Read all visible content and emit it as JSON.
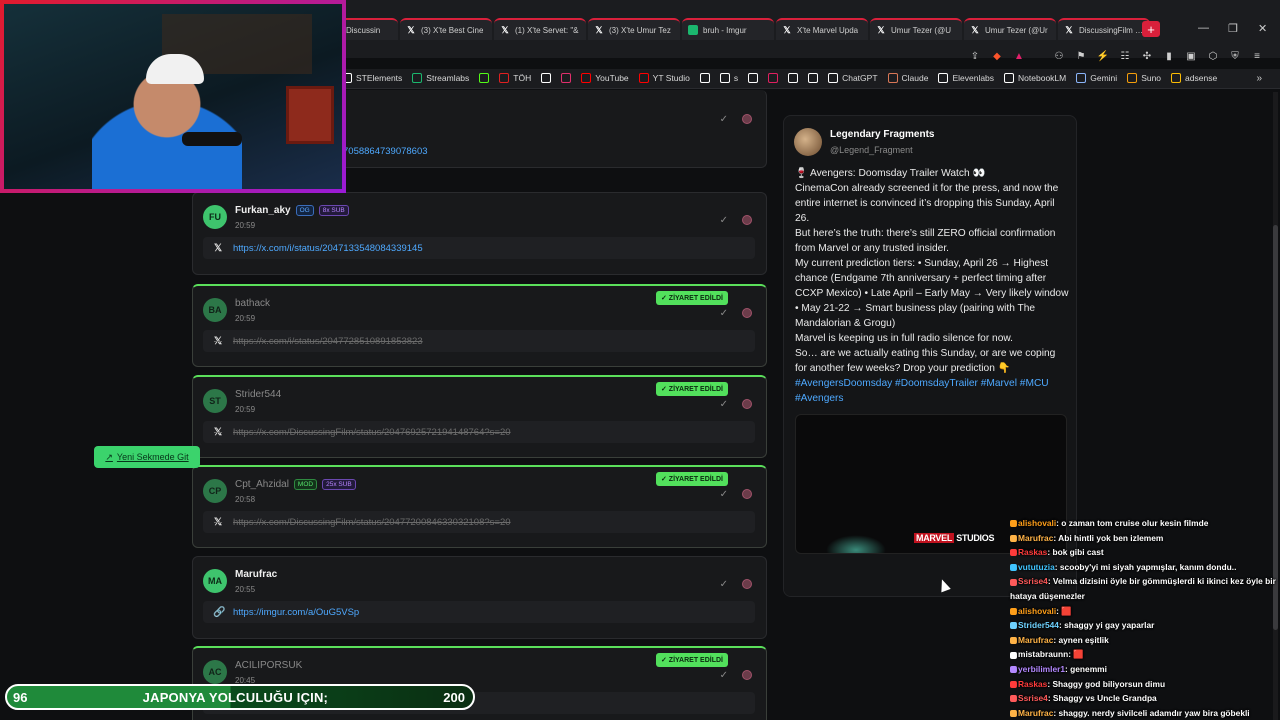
{
  "tabs": [
    {
      "icon": "",
      "label": "Discussin"
    },
    {
      "icon": "X",
      "label": "(3) X'te Best Cine"
    },
    {
      "icon": "X",
      "label": "(1) X'te Servet: \"&"
    },
    {
      "icon": "X",
      "label": "(3) X'te Umur Tez"
    },
    {
      "icon": "imgur",
      "label": "bruh - Imgur"
    },
    {
      "icon": "X",
      "label": "X'te Marvel Upda"
    },
    {
      "icon": "X",
      "label": "Umur Tezer (@U"
    },
    {
      "icon": "X",
      "label": "Umur Tezer (@Ur"
    },
    {
      "icon": "X",
      "label": "DiscussingFilm (@"
    }
  ],
  "new_tab": "+",
  "bookmarks": [
    {
      "label": "STElements",
      "color": "#ffffff"
    },
    {
      "label": "Streamlabs",
      "color": "#1bb76e"
    },
    {
      "label": "",
      "color": "#53fc18"
    },
    {
      "label": "TÖH",
      "color": "#e02020"
    },
    {
      "label": "",
      "color": "#ffffff"
    },
    {
      "label": "",
      "color": "#e1306c"
    },
    {
      "label": "YouTube",
      "color": "#ff0000"
    },
    {
      "label": "YT Studio",
      "color": "#ff0000"
    },
    {
      "label": "",
      "color": "#ffffff"
    },
    {
      "label": "s",
      "color": "#ffffff"
    },
    {
      "label": "",
      "color": "#ffffff"
    },
    {
      "label": "",
      "color": "#e02060"
    },
    {
      "label": "",
      "color": "#ffffff"
    },
    {
      "label": "",
      "color": "#ffffff"
    },
    {
      "label": "ChatGPT",
      "color": "#ffffff"
    },
    {
      "label": "Claude",
      "color": "#d97757"
    },
    {
      "label": "Elevenlabs",
      "color": "#ffffff"
    },
    {
      "label": "NotebookLM",
      "color": "#ffffff"
    },
    {
      "label": "Gemini",
      "color": "#8ab4f8"
    },
    {
      "label": "Suno",
      "color": "#f59e0b"
    },
    {
      "label": "adsense",
      "color": "#fbbc04"
    }
  ],
  "messages": [
    {
      "initials": "",
      "user": "",
      "time": "",
      "link": "7058864739078603",
      "link_icon": "X",
      "visited": false,
      "badges": []
    },
    {
      "initials": "FU",
      "user": "Furkan_aky",
      "time": "20:59",
      "link": "https://x.com/i/status/2047133548084339145",
      "link_icon": "X",
      "visited": false,
      "badges": [
        {
          "text": "OG",
          "kind": "og"
        },
        {
          "text": "8x SUB",
          "kind": "sub"
        }
      ]
    },
    {
      "initials": "BA",
      "user": "bathack",
      "time": "20:59",
      "link": "https://x.com/i/status/2047728510891853823",
      "link_icon": "X",
      "visited": true,
      "badges": []
    },
    {
      "initials": "ST",
      "user": "Strider544",
      "time": "20:59",
      "link": "https://x.com/DiscussingFilm/status/2047692572194148764?s=20",
      "link_icon": "X",
      "visited": true,
      "badges": []
    },
    {
      "initials": "CP",
      "user": "Cpt_Ahzidal",
      "time": "20:58",
      "link": "https://x.com/DiscussingFilm/status/2047720084633032108?s=20",
      "link_icon": "X",
      "visited": true,
      "badges": [
        {
          "text": "MOD",
          "kind": "mod"
        },
        {
          "text": "25x SUB",
          "kind": "sub"
        }
      ]
    },
    {
      "initials": "MA",
      "user": "Marufrac",
      "time": "20:55",
      "link": "https://imgur.com/a/OuG5VSp",
      "link_icon": "link",
      "visited": false,
      "badges": []
    },
    {
      "initials": "AC",
      "user": "ACILIPORSUK",
      "time": "20:45",
      "link": "",
      "link_icon": "X",
      "visited": true,
      "badges": []
    }
  ],
  "visited_label": "✓ ZİYARET EDİLDİ",
  "preview": {
    "name": "Legendary Fragments",
    "handle": "@Legend_Fragment",
    "paragraphs": [
      "🍷 Avengers: Doomsday Trailer Watch 👀",
      "CinemaCon already screened it for the press, and now the entire internet is convinced it’s dropping this Sunday, April 26.",
      "But here’s the truth: there’s still ZERO official confirmation from Marvel or any trusted insider.",
      "My current prediction tiers: • Sunday, April 26 → Highest chance (Endgame 7th anniversary + perfect timing after CCXP Mexico) • Late April – Early May → Very likely window • May 21-22 → Smart business play (pairing with The Mandalorian & Grogu)",
      "Marvel is keeping us in full radio silence for now.",
      "So… are we actually eating this Sunday, or are we coping for another few weeks? Drop your prediction 👇"
    ],
    "hashtags": "#AvengersDoomsday #DoomsdayTrailer #Marvel #MCU #Avengers",
    "studio_logo_a": "MARVEL",
    "studio_logo_b": "STUDIOS",
    "open_button": "Yeni Sekmede Git",
    "open_icon": "↗"
  },
  "chat": [
    {
      "user": "alishovali",
      "color": "#ff9f1a",
      "msg": ": o zaman tom cruise olur kesin filmde"
    },
    {
      "user": "Marufrac",
      "color": "#ffb347",
      "msg": ": Abi hintli yok ben izlemem"
    },
    {
      "user": "Raskas",
      "color": "#ff3b3b",
      "msg": ": bok gibi cast"
    },
    {
      "user": "vututuzia",
      "color": "#40c4ff",
      "msg": ": scooby'yi mi siyah yapmışlar, kanım dondu.."
    },
    {
      "user": "Ssrise4",
      "color": "#ff5a5a",
      "msg": ": Velma dizisini öyle bir gömmüşlerdi ki ikinci kez öyle bir hataya düşemezler"
    },
    {
      "user": "alishovali",
      "color": "#ff9f1a",
      "msg": ": 🟥"
    },
    {
      "user": "Strider544",
      "color": "#6fd2ff",
      "msg": ": shaggy yi gay yaparlar"
    },
    {
      "user": "Marufrac",
      "color": "#ffb347",
      "msg": ": aynen eşitlik"
    },
    {
      "user": "mistabraunn",
      "color": "#ffffff",
      "msg": ": 🟥"
    },
    {
      "user": "yerbilimler1",
      "color": "#b388ff",
      "msg": ": genemmi"
    },
    {
      "user": "Raskas",
      "color": "#ff3b3b",
      "msg": ": Shaggy god biliyorsun dimu"
    },
    {
      "user": "Ssrise4",
      "color": "#ff5a5a",
      "msg": ": Shaggy vs Uncle Grandpa"
    },
    {
      "user": "Marufrac",
      "color": "#ffb347",
      "msg": ": shaggy. nerdy sivilceli adamdır yaw bira göbekli"
    }
  ],
  "goal": {
    "current": "96",
    "title": "JAPONYA YOLCULUĞU IÇIN;",
    "target": "200",
    "progress": 0.48
  }
}
